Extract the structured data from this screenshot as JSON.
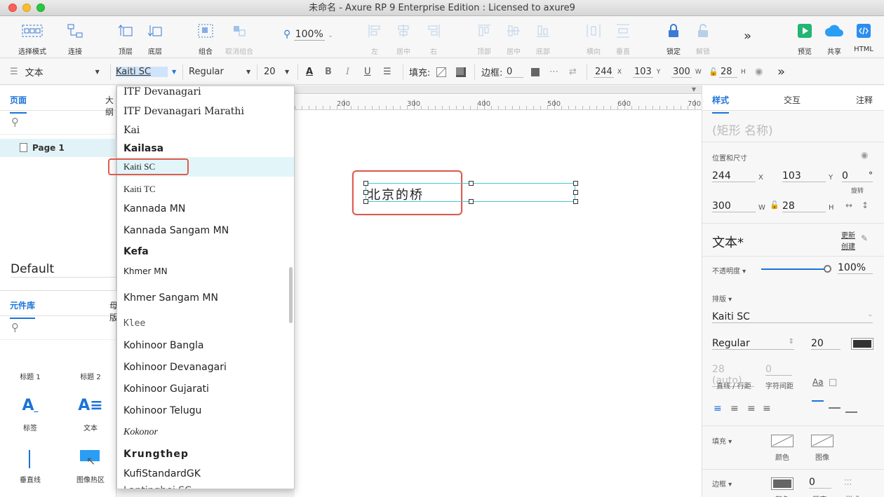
{
  "window": {
    "title": "未命名 - Axure RP 9 Enterprise Edition : Licensed to axure9"
  },
  "toolbar": {
    "select_mode": "选择模式",
    "connect": "连接",
    "top_layer": "顶层",
    "bottom_layer": "底层",
    "group": "组合",
    "ungroup": "取消组合",
    "zoom": "100%",
    "align_left": "左",
    "align_center": "居中",
    "align_right": "右",
    "align_top": "顶部",
    "align_middle": "居中",
    "align_bottom": "底部",
    "distribute_h": "横向",
    "distribute_v": "垂直",
    "lock": "锁定",
    "unlock": "解锁",
    "more": "»",
    "preview": "预览",
    "share": "共享",
    "html": "HTML"
  },
  "formatbar": {
    "style": "文本",
    "font": "Kaiti SC",
    "weight": "Regular",
    "size": "20",
    "bold": "B",
    "italic": "I",
    "underline": "U",
    "fill_label": "填充:",
    "border_label": "边框:",
    "border_value": "0",
    "x": "244",
    "x_unit": "X",
    "y": "103",
    "y_unit": "Y",
    "w": "300",
    "w_unit": "W",
    "h": "28",
    "h_unit": "H",
    "more": "»"
  },
  "left": {
    "tab_pages": "页面",
    "tab_outline": "大纲",
    "page_item": "Page 1",
    "tab_library": "元件库",
    "tab_masters": "母版",
    "library_name": "Default",
    "widgets": {
      "h1": "标题 1",
      "h2": "标题 2",
      "label": "标签",
      "text": "文本",
      "vline": "垂直线",
      "hotspot": "图像热区"
    }
  },
  "ruler": {
    "ticks": [
      "200",
      "300",
      "400",
      "500",
      "600",
      "700"
    ]
  },
  "canvas": {
    "text": "北京的桥"
  },
  "dropdown": {
    "fonts": [
      "ITF Devanagari",
      "ITF Devanagari Marathi",
      "Kai",
      "Kailasa",
      "Kaiti SC",
      "Kaiti TC",
      "Kannada MN",
      "Kannada Sangam MN",
      "Kefa",
      "Khmer MN",
      "Khmer Sangam MN",
      "Klee",
      "Kohinoor Bangla",
      "Kohinoor Devanagari",
      "Kohinoor Gujarati",
      "Kohinoor Telugu",
      "Kokonor",
      "Krungthep",
      "KufiStandardGK",
      "Lantinghei SC"
    ],
    "selected": "Kaiti SC"
  },
  "right": {
    "tab_style": "样式",
    "tab_interact": "交互",
    "tab_notes": "注释",
    "shape_name_placeholder": "(矩形 名称)",
    "pos_size": "位置和尺寸",
    "x": "244",
    "x_unit": "X",
    "y": "103",
    "y_unit": "Y",
    "rotation": "0",
    "rotation_unit": "°",
    "rotation_label": "旋转",
    "w": "300",
    "w_unit": "W",
    "h": "28",
    "h_unit": "H",
    "style_name": "文本*",
    "update": "更新",
    "create": "创建",
    "opacity_label": "不透明度",
    "opacity": "100%",
    "typography": "排版",
    "font": "Kaiti SC",
    "weight": "Regular",
    "size": "20",
    "line_height": "28 (auto)",
    "letter_spacing": "0",
    "line_height_label": "直线 / 行距",
    "letter_spacing_label": "字符间距",
    "aa": "Aa",
    "fill_label": "填充",
    "fill_color": "颜色",
    "fill_image": "图像",
    "border_label": "边框",
    "border_value": "0",
    "border_color": "颜色",
    "border_thickness": "厚度",
    "border_style": "样式"
  },
  "colors": {
    "accent": "#1a73d9",
    "highlight": "#e05a4e",
    "selection": "#46c5d4"
  }
}
